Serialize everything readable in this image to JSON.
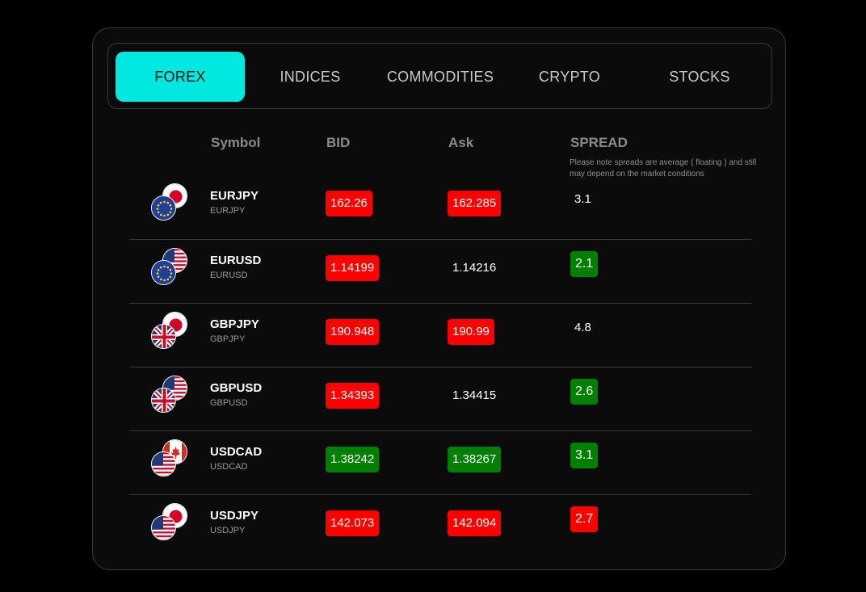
{
  "tabs": [
    {
      "label": "FOREX",
      "active": true
    },
    {
      "label": "INDICES",
      "active": false
    },
    {
      "label": "COMMODITIES",
      "active": false
    },
    {
      "label": "CRYPTO",
      "active": false
    },
    {
      "label": "STOCKS",
      "active": false
    }
  ],
  "table": {
    "headers": {
      "symbol": "Symbol",
      "bid": "BID",
      "ask": "Ask",
      "spread": "SPREAD"
    },
    "spread_note": "Please note spreads are average ( floating ) and still may depend on the market conditions",
    "rows": [
      {
        "symbol": "EURJPY",
        "sub": "EURJPY",
        "bid": "162.26",
        "bid_state": "red",
        "ask": "162.285",
        "ask_state": "red",
        "spread": "3.1",
        "spread_state": "plain",
        "flags": [
          "jp",
          "eu"
        ]
      },
      {
        "symbol": "EURUSD",
        "sub": "EURUSD",
        "bid": "1.14199",
        "bid_state": "red",
        "ask": "1.14216",
        "ask_state": "plain",
        "spread": "2.1",
        "spread_state": "green",
        "flags": [
          "us",
          "eu"
        ]
      },
      {
        "symbol": "GBPJPY",
        "sub": "GBPJPY",
        "bid": "190.948",
        "bid_state": "red",
        "ask": "190.99",
        "ask_state": "red",
        "spread": "4.8",
        "spread_state": "plain",
        "flags": [
          "jp",
          "gb"
        ]
      },
      {
        "symbol": "GBPUSD",
        "sub": "GBPUSD",
        "bid": "1.34393",
        "bid_state": "red",
        "ask": "1.34415",
        "ask_state": "plain",
        "spread": "2.6",
        "spread_state": "green",
        "flags": [
          "us",
          "gb"
        ]
      },
      {
        "symbol": "USDCAD",
        "sub": "USDCAD",
        "bid": "1.38242",
        "bid_state": "green",
        "ask": "1.38267",
        "ask_state": "green",
        "spread": "3.1",
        "spread_state": "green",
        "flags": [
          "ca",
          "us"
        ]
      },
      {
        "symbol": "USDJPY",
        "sub": "USDJPY",
        "bid": "142.073",
        "bid_state": "red",
        "ask": "142.094",
        "ask_state": "red",
        "spread": "2.7",
        "spread_state": "red",
        "flags": [
          "jp",
          "us"
        ]
      }
    ]
  },
  "colors": {
    "accent": "#00e8e0",
    "down": "#ff0000",
    "up": "#008000"
  }
}
